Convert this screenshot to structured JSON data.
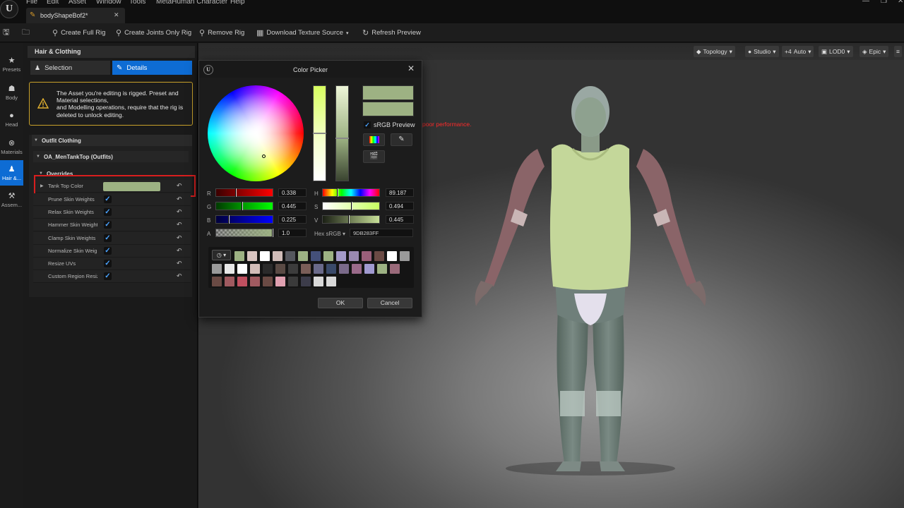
{
  "menu": {
    "items": [
      "File",
      "Edit",
      "Asset",
      "Window",
      "Tools",
      "MetaHuman Character",
      "Help"
    ],
    "logo": "U"
  },
  "document_tab": {
    "label": "bodyShapeBof2*",
    "close": "✕"
  },
  "toolbar": {
    "create_full_rig": "Create Full Rig",
    "create_joints_only_rig": "Create Joints Only Rig",
    "remove_rig": "Remove Rig",
    "download_texture_source": "Download Texture Source",
    "refresh_preview": "Refresh Preview"
  },
  "nav": [
    {
      "label": "Presets",
      "icon": "star-icon"
    },
    {
      "label": "Body",
      "icon": "body-icon"
    },
    {
      "label": "Head",
      "icon": "head-icon"
    },
    {
      "label": "Materials",
      "icon": "materials-icon"
    },
    {
      "label": "Hair &...",
      "icon": "hair-clothing-icon",
      "active": true
    },
    {
      "label": "Assem...",
      "icon": "hammer-icon"
    }
  ],
  "panel": {
    "title": "Hair & Clothing",
    "tab_selection": "Selection",
    "tab_details": "Details",
    "warning": "The Asset you're editing is rigged. Preset and Material selections,\nand Modelling operations, require that the rig is deleted to unlock editing.",
    "section_outfit": "Outfit Clothing",
    "subsection": "OA_MenTankTop (Outfits)",
    "overrides": "Overrides",
    "tank_top_color_label": "Tank Top Color",
    "tank_top_color": "#9db283",
    "properties": [
      {
        "label": "Prune Skin Weights",
        "checked": true
      },
      {
        "label": "Relax Skin Weights",
        "checked": true
      },
      {
        "label": "Hammer Skin Weights",
        "checked": true
      },
      {
        "label": "Clamp Skin Weights",
        "checked": true
      },
      {
        "label": "Normalize Skin Weights",
        "checked": true
      },
      {
        "label": "Resize UVs",
        "checked": true
      },
      {
        "label": "Custom Region Resizing",
        "checked": true
      }
    ]
  },
  "viewport": {
    "buttons": [
      "Topology",
      "Studio",
      "Auto",
      "LOD0",
      "Epic"
    ],
    "auto_prefix": "+4",
    "warning_text": "poor performance."
  },
  "color_picker": {
    "title": "Color Picker",
    "srgb_preview": "sRGB Preview",
    "r": "0.338",
    "g": "0.445",
    "b": "0.225",
    "a": "1.0",
    "h": "89.187",
    "s": "0.494",
    "v": "0.445",
    "hex_label": "Hex sRGB",
    "hex": "9DB283FF",
    "current_color": "#9db283",
    "ok": "OK",
    "cancel": "Cancel",
    "palette": [
      "#9db283",
      "#d8c4c0",
      "#ffffff",
      "#d0bcb8",
      "#55575e",
      "#9db283",
      "#44507a",
      "#9db283",
      "#a49ac8",
      "#9a8ab0",
      "#9a5f7a",
      "#6a4a44",
      "#ffffff",
      "#9a9a9a",
      "#9a9a9a",
      "#e8e8e8",
      "#ffffff",
      "#d2bcb8",
      "#2a2a2a",
      "#5a4a44",
      "#3c3c3c",
      "#7a5e58",
      "#6a6a8a",
      "#3a4a6a",
      "#7a6a8a",
      "#9a6a8a",
      "#a09ad0",
      "#9db283",
      "#9a6a7a",
      "#6a4a44",
      "#a05a60",
      "#c05060",
      "#a05a60",
      "#6a4a44",
      "#e0a0b0",
      "#3a3a3a",
      "#3c3c4a",
      "#d8d8d8",
      "#d8d8d8"
    ]
  }
}
